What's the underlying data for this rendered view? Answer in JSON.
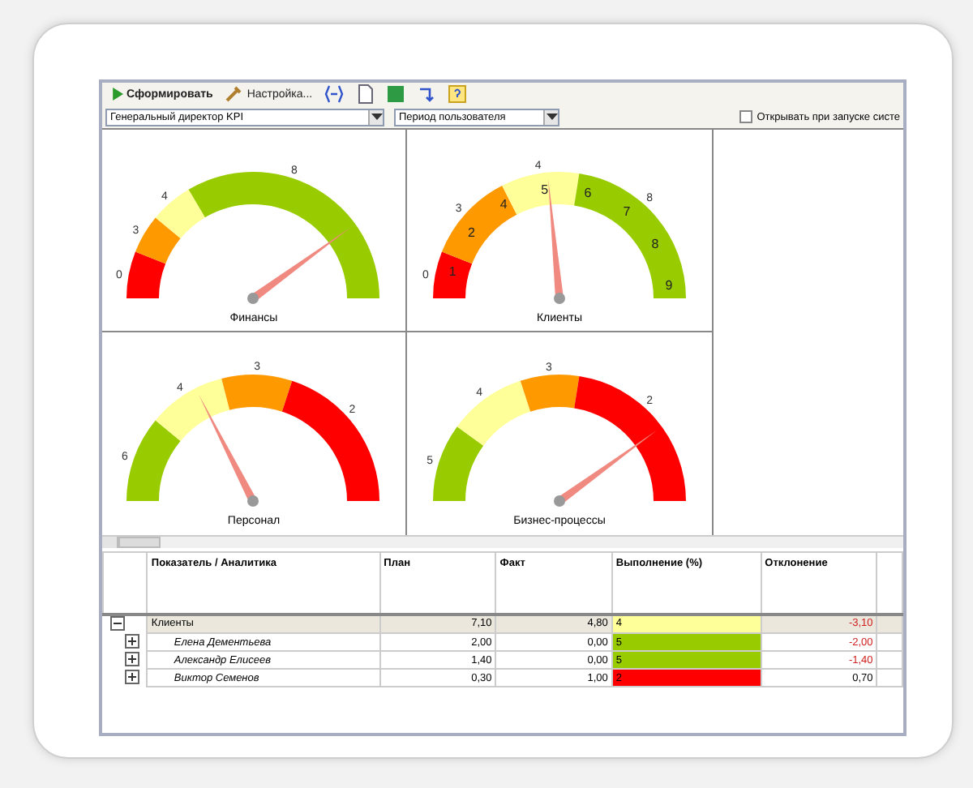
{
  "toolbar": {
    "buttons": [
      {
        "kind": "run",
        "label": "Сформировать"
      },
      {
        "kind": "settings",
        "label": "Настройка..."
      },
      {
        "kind": "link"
      },
      {
        "kind": "page"
      },
      {
        "kind": "sheet"
      },
      {
        "kind": "arrow"
      },
      {
        "kind": "help"
      }
    ]
  },
  "filters": {
    "profile": "Генеральный директор KPI",
    "period": "Период пользователя",
    "autostart": {
      "label": "Открывать при запуске систе",
      "checked": false
    }
  },
  "gauges": [
    {
      "caption": "Финансы",
      "segments": [
        {
          "color": "#ff0000",
          "label": "0"
        },
        {
          "color": "#ff9900",
          "label": "3"
        },
        {
          "color": "#ffff99",
          "label": "4"
        },
        {
          "color": "#99cc00",
          "label": "8"
        }
      ]
    },
    {
      "caption": "Клиенты",
      "segments": [
        {
          "color": "#ff0000",
          "label": "0"
        },
        {
          "color": "#ff9900",
          "label": "3"
        },
        {
          "color": "#ffff99",
          "label": "4"
        },
        {
          "color": "#99cc00",
          "label": "8"
        }
      ],
      "scale": [
        "1",
        "2",
        "4",
        "5",
        "6",
        "7",
        "8",
        "9"
      ]
    },
    {
      "caption": "Персонал",
      "segments": [
        {
          "color": "#99cc00",
          "label": "6"
        },
        {
          "color": "#ffff99",
          "label": "4"
        },
        {
          "color": "#ff9900",
          "label": "3"
        },
        {
          "color": "#ff0000",
          "label": "2"
        }
      ]
    },
    {
      "caption": "Бизнес-процессы",
      "segments": [
        {
          "color": "#99cc00",
          "label": "5"
        },
        {
          "color": "#ffff99",
          "label": "4"
        },
        {
          "color": "#ff9900",
          "label": "3"
        },
        {
          "color": "#ff0000",
          "label": "2"
        }
      ]
    }
  ],
  "table": {
    "columns": [
      "Показатель / Аналитика",
      "План",
      "Факт",
      "Выполнение (%)",
      "Отклонение"
    ],
    "rows": [
      {
        "name": "Клиенты",
        "plan": "7,10",
        "fact": "4,80",
        "score": "4",
        "color": "#ffff99",
        "deviation": "-3,10",
        "negative": true,
        "expanded": true,
        "children": [
          {
            "name": "Елена Дементьева",
            "plan": "2,00",
            "fact": "0,00",
            "score": "5",
            "color": "#99cc00",
            "deviation": "-2,00",
            "negative": true,
            "expanded": false
          },
          {
            "name": "Александр Елисеев",
            "plan": "1,40",
            "fact": "0,00",
            "score": "5",
            "color": "#99cc00",
            "deviation": "-1,40",
            "negative": true,
            "expanded": false
          },
          {
            "name": "Виктор Семенов",
            "plan": "0,30",
            "fact": "1,00",
            "score": "2",
            "color": "#ff0000",
            "deviation": "0,70",
            "negative": false,
            "expanded": false
          }
        ]
      }
    ]
  }
}
